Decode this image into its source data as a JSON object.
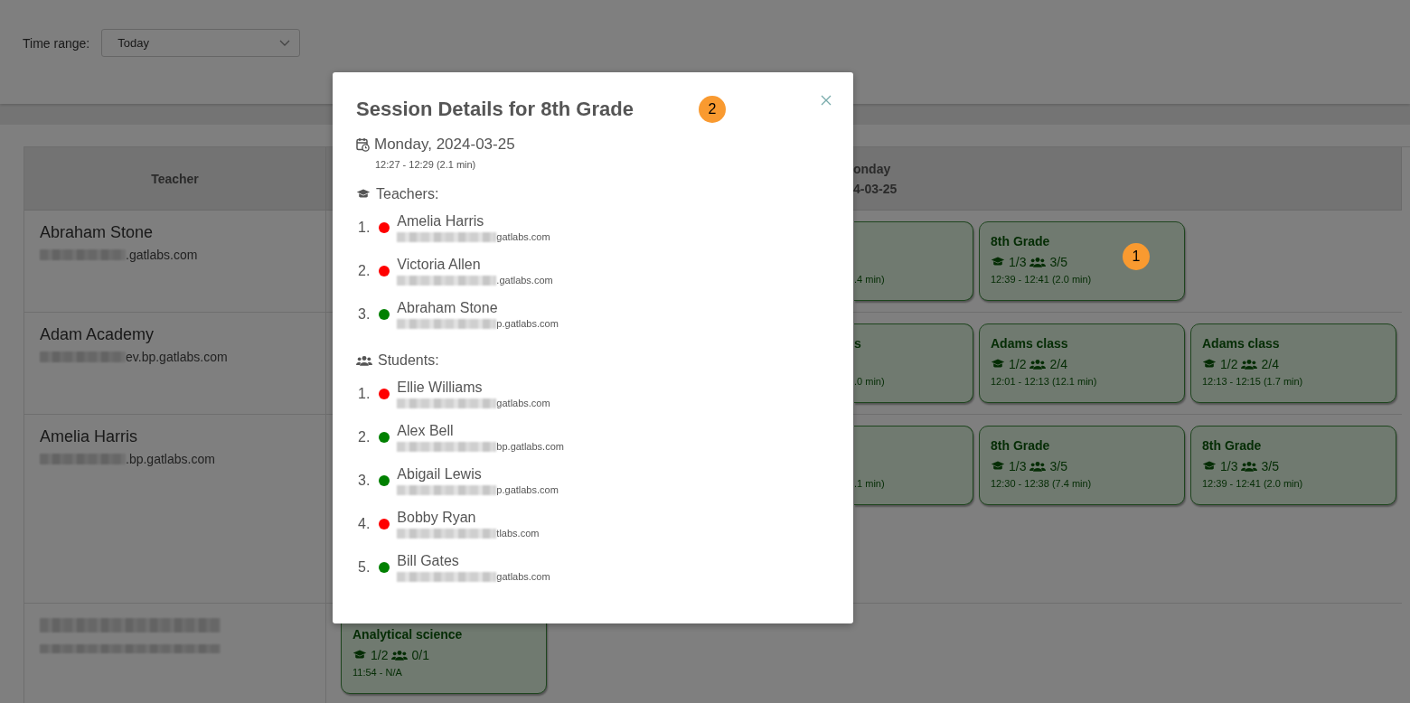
{
  "filter": {
    "label": "Time range:",
    "value": "Today"
  },
  "table": {
    "columns": [
      {
        "lines": [
          "Teacher"
        ]
      },
      {
        "lines": [
          "onday",
          "4-03-25"
        ]
      }
    ],
    "rows": [
      {
        "teacher": {
          "redacted": false,
          "name": "Abraham Stone",
          "email": ".gatlabs.com"
        },
        "sessions": [
          {
            "kind": "partial",
            "time": ".4 min)"
          },
          {
            "kind": "card",
            "title": "8th Grade",
            "teachers": "1/3",
            "students": "3/5",
            "time": "12:39 - 12:41 (2.0 min)"
          }
        ]
      },
      {
        "teacher": {
          "redacted": false,
          "name": "Adam Academy",
          "email": "ev.bp.gatlabs.com"
        },
        "sessions": [
          {
            "kind": "partial",
            "title": "s",
            "time": ".0 min)"
          },
          {
            "kind": "card",
            "title": "Adams class",
            "teachers": "1/2",
            "students": "2/4",
            "time": "12:01 - 12:13 (12.1 min)"
          },
          {
            "kind": "card",
            "title": "Adams class",
            "teachers": "1/2",
            "students": "2/4",
            "time": "12:13 - 12:15 (1.7 min)"
          }
        ]
      },
      {
        "teacher": {
          "redacted": false,
          "name": "Amelia Harris",
          "email": ".bp.gatlabs.com"
        },
        "sessions": [
          {
            "kind": "partial",
            "time": ".1 min)"
          },
          {
            "kind": "card",
            "title": "8th Grade",
            "teachers": "1/3",
            "students": "3/5",
            "time": "12:30 - 12:38 (7.4 min)"
          },
          {
            "kind": "card",
            "title": "8th Grade",
            "teachers": "1/3",
            "students": "3/5",
            "time": "12:39 - 12:41 (2.0 min)"
          }
        ]
      },
      {
        "teacher": {
          "redacted": true
        },
        "sessions": [
          {
            "kind": "card",
            "title": "Analytical science",
            "teachers": "1/2",
            "students": "0/1",
            "time": "11:54 - N/A"
          }
        ]
      }
    ]
  },
  "modal": {
    "title": "Session Details for 8th Grade",
    "date": "Monday, 2024-03-25",
    "time": "12:27 - 12:29 (2.1 min)",
    "sections": [
      {
        "kind": "teachers",
        "heading": "Teachers:",
        "people": [
          {
            "number": "1.",
            "name": "Amelia Harris",
            "email": "gatlabs.com",
            "color": "#ff0000"
          },
          {
            "number": "2.",
            "name": "Victoria Allen",
            "email": ".gatlabs.com",
            "color": "#ff0000"
          },
          {
            "number": "3.",
            "name": "Abraham Stone",
            "email": "p.gatlabs.com",
            "color": "#008000"
          }
        ]
      },
      {
        "kind": "students",
        "heading": "Students:",
        "people": [
          {
            "number": "1.",
            "name": "Ellie Williams",
            "email": "gatlabs.com",
            "color": "#ff0000"
          },
          {
            "number": "2.",
            "name": "Alex Bell",
            "email": "bp.gatlabs.com",
            "color": "#008000"
          },
          {
            "number": "3.",
            "name": "Abigail Lewis",
            "email": "p.gatlabs.com",
            "color": "#008000"
          },
          {
            "number": "4.",
            "name": "Bobby Ryan",
            "email": "tlabs.com",
            "color": "#ff0000"
          },
          {
            "number": "5.",
            "name": "Bill Gates",
            "email": "gatlabs.com",
            "color": "#008000"
          }
        ]
      }
    ]
  },
  "annotations": [
    {
      "label": "1"
    },
    {
      "label": "2"
    }
  ]
}
